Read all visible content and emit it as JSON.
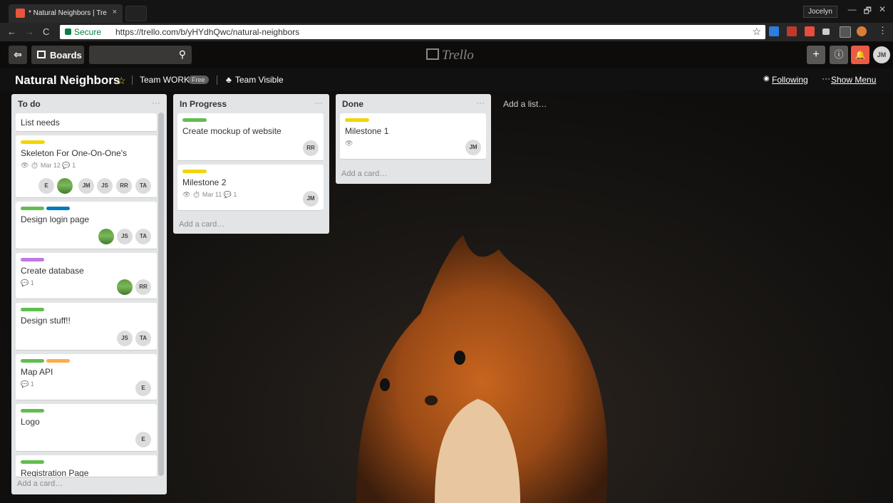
{
  "browser": {
    "tab_title": "* Natural Neighbors | Tre",
    "tab_close": "×",
    "profile_name": "Jocelyn",
    "window_controls": [
      "—",
      "🗗",
      "✕"
    ],
    "nav": {
      "back": "←",
      "forward": "→",
      "reload": "C"
    },
    "secure_label": "Secure",
    "url": "https://trello.com/b/yHYdhQwc/natural-neighbors",
    "bookmark_icon": "☆"
  },
  "header": {
    "back_icon": "⇦",
    "boards_label": "Boards",
    "search_placeholder": "",
    "search_icon": "⚲",
    "logo_text": "Trello",
    "add_icon": "+",
    "info_icon": "ⓘ",
    "bell_icon": "🔔",
    "avatar": "JM"
  },
  "board": {
    "name": "Natural Neighbors",
    "star": "☆",
    "team": "Team WORK",
    "team_badge": "Free",
    "visibility": "Team Visible",
    "following": "Following",
    "show_menu": "Show Menu"
  },
  "lists": [
    {
      "title": "To do",
      "add_card": "Add a card…",
      "cards": [
        {
          "text": "List needs"
        },
        {
          "text": "Skeleton For One-On-One's",
          "labels": [
            "#f2d600"
          ],
          "badges": "👁   ⏱ Mar 12   💬 1",
          "members": [
            "E",
            "photo",
            "JM",
            "JS",
            "RR",
            "TA"
          ]
        },
        {
          "text": "Design login page",
          "labels": [
            "#61bd4f",
            "#0079bf"
          ],
          "members": [
            "photo",
            "JS",
            "TA"
          ]
        },
        {
          "text": "Create database",
          "labels": [
            "#c377e0"
          ],
          "badges": "💬 1",
          "members": [
            "photo",
            "RR"
          ]
        },
        {
          "text": "Design stuff!!",
          "labels": [
            "#61bd4f"
          ],
          "members": [
            "JS",
            "TA"
          ]
        },
        {
          "text": "Map API",
          "labels": [
            "#61bd4f",
            "#ffab4a"
          ],
          "badges": "💬 1",
          "members": [
            "E"
          ]
        },
        {
          "text": "Logo",
          "labels": [
            "#61bd4f"
          ],
          "members": [
            "E"
          ]
        },
        {
          "text": "Registration Page",
          "labels": [
            "#61bd4f"
          ]
        }
      ]
    },
    {
      "title": "In Progress",
      "add_card": "Add a card…",
      "cards": [
        {
          "text": "Create mockup of website",
          "labels": [
            "#61bd4f"
          ],
          "members": [
            "RR"
          ]
        },
        {
          "text": "Milestone 2",
          "labels": [
            "#f2d600"
          ],
          "badges": "👁   ⏱ Mar 11   💬 1",
          "members": [
            "JM"
          ]
        }
      ]
    },
    {
      "title": "Done",
      "add_card": "Add a card…",
      "cards": [
        {
          "text": "Milestone 1",
          "labels": [
            "#f2d600"
          ],
          "badges": "👁",
          "members": [
            "JM"
          ]
        }
      ]
    }
  ],
  "add_list": "Add a list…",
  "colors": {
    "trello_red": "#eb5a46",
    "chrome_dark": "#141414"
  }
}
